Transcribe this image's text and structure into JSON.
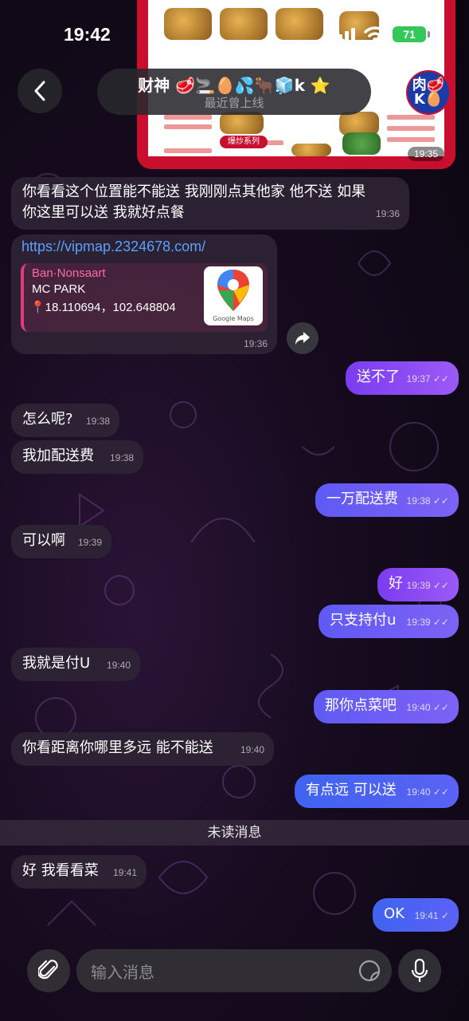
{
  "status_bar": {
    "time": "19:42",
    "battery": "71"
  },
  "header": {
    "title": "财神 🥩🚬🥚💦🐂🧊k ⭐",
    "subtitle": "最近曾上线",
    "avatar_line1": "肉🥩",
    "avatar_line2": "K🥚"
  },
  "top_image": {
    "banner": "爆炒系列",
    "time": "19:35"
  },
  "messages": [
    {
      "text_line1": "你看看这个位置能不能送 我刚刚点其他家 他不送 如果",
      "text_line2": "你这里可以送 我就好点餐",
      "time": "19:36"
    },
    {
      "url": "https://vipmap.2324678.com/",
      "preview_site": "Ban·Nonsaart",
      "preview_title": "MC PARK",
      "preview_desc": "📍18.110694，102.648804",
      "thumb_label": "Google Maps",
      "time": "19:36"
    },
    {
      "text": "送不了",
      "time": "19:37"
    },
    {
      "text": "怎么呢?",
      "time": "19:38"
    },
    {
      "text": "我加配送费",
      "time": "19:38"
    },
    {
      "text": "一万配送费",
      "time": "19:38"
    },
    {
      "text": "可以啊",
      "time": "19:39"
    },
    {
      "text": "好",
      "time": "19:39"
    },
    {
      "text": "只支持付u",
      "time": "19:39"
    },
    {
      "text": "我就是付U",
      "time": "19:40"
    },
    {
      "text": "那你点菜吧",
      "time": "19:40"
    },
    {
      "text": "你看距离你哪里多远 能不能送",
      "time": "19:40"
    },
    {
      "text": "有点远 可以送",
      "time": "19:40"
    },
    {
      "text": "好 我看看菜",
      "time": "19:41"
    },
    {
      "text": "OK",
      "time": "19:41"
    }
  ],
  "unread_label": "未读消息",
  "input": {
    "placeholder": "输入消息"
  },
  "colors": {
    "outgoing_start": "#7b3cf0",
    "outgoing_end": "#5b62f4",
    "link": "#5aa0ff",
    "battery": "#34c759"
  }
}
